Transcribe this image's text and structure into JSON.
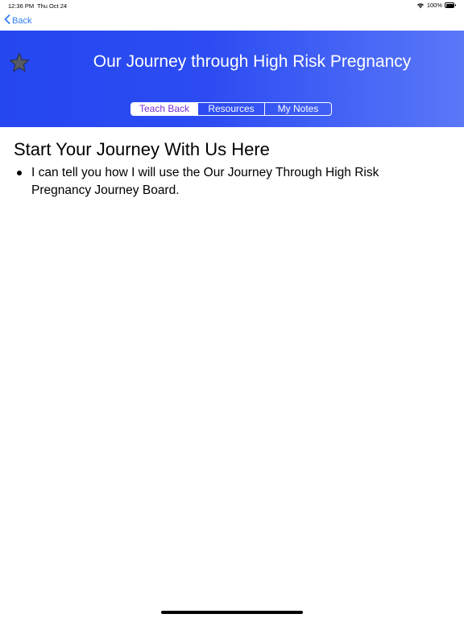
{
  "status_bar": {
    "time": "12:36 PM",
    "date": "Thu Oct 24",
    "battery": "100%",
    "wifi_icon": "wifi-icon",
    "battery_icon": "battery-icon"
  },
  "nav": {
    "back_label": "Back",
    "back_icon": "chevron-left-icon"
  },
  "header": {
    "title": "Our Journey through High Risk Pregnancy",
    "favorite_icon": "star-icon",
    "gradient_start": "#2547f0",
    "gradient_end": "#5a78f8",
    "tabs": [
      {
        "label": "Teach Back",
        "active": true
      },
      {
        "label": "Resources",
        "active": false
      },
      {
        "label": "My Notes",
        "active": false
      }
    ],
    "active_tab_text_color": "#7b2fd6"
  },
  "content": {
    "title": "Start Your Journey With Us Here",
    "bullets": [
      "I can tell you how I will use the Our Journey Through High Risk Pregnancy Journey Board."
    ]
  },
  "colors": {
    "accent": "#2f7cf6",
    "header_blue": "#2547f0"
  }
}
